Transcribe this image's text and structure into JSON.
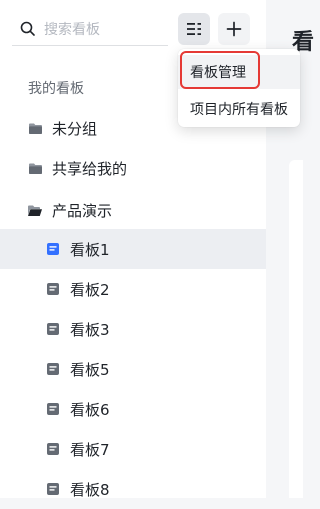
{
  "search": {
    "placeholder": "搜索看板",
    "icon": "search-icon"
  },
  "toolbar": {
    "menu_icon": "list-settings-icon",
    "add_icon": "plus-icon"
  },
  "sidebar": {
    "section_title": "我的看板",
    "folders": [
      {
        "label": "未分组",
        "icon": "folder-icon"
      },
      {
        "label": "共享给我的",
        "icon": "folder-icon"
      },
      {
        "label": "产品演示",
        "icon": "folder-open-icon"
      }
    ],
    "boards": [
      {
        "label": "看板1",
        "selected": true
      },
      {
        "label": "看板2",
        "selected": false
      },
      {
        "label": "看板3",
        "selected": false
      },
      {
        "label": "看板5",
        "selected": false
      },
      {
        "label": "看板6",
        "selected": false
      },
      {
        "label": "看板7",
        "selected": false
      },
      {
        "label": "看板8",
        "selected": false
      }
    ]
  },
  "dropdown": {
    "items": [
      {
        "label": "看板管理"
      },
      {
        "label": "项目内所有看板"
      }
    ]
  },
  "main": {
    "title_partial": "看"
  },
  "colors": {
    "accent_blue": "#3370ff",
    "highlight_red": "#e53935",
    "selected_row": "#eceef2"
  }
}
